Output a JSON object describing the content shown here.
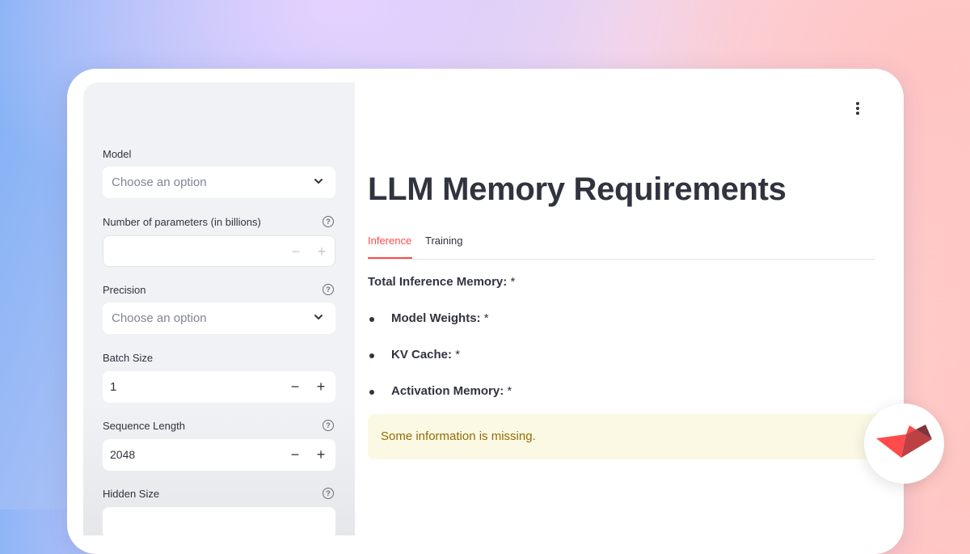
{
  "sidebar": {
    "model": {
      "label": "Model",
      "placeholder": "Choose an option"
    },
    "num_params": {
      "label": "Number of parameters (in billions)",
      "value": "",
      "minus": "−",
      "plus": "+"
    },
    "precision": {
      "label": "Precision",
      "placeholder": "Choose an option"
    },
    "batch_size": {
      "label": "Batch Size",
      "value": "1",
      "minus": "−",
      "plus": "+"
    },
    "sequence_length": {
      "label": "Sequence Length",
      "value": "2048",
      "minus": "−",
      "plus": "+"
    },
    "hidden_size": {
      "label": "Hidden Size"
    },
    "help_glyph": "?"
  },
  "main": {
    "title": "LLM Memory Requirements",
    "tabs": [
      {
        "label": "Inference",
        "active": true
      },
      {
        "label": "Training",
        "active": false
      }
    ],
    "total_inference": {
      "label": "Total Inference Memory:",
      "value": "*"
    },
    "items": [
      {
        "label": "Model Weights:",
        "value": "*"
      },
      {
        "label": "KV Cache:",
        "value": "*"
      },
      {
        "label": "Activation Memory:",
        "value": "*"
      }
    ],
    "alert": "Some information is missing."
  },
  "colors": {
    "accent": "#ff4b4b",
    "text": "#31333f",
    "sidebar_bg": "#f0f2f6",
    "alert_bg": "#fbf9e4",
    "alert_text": "#926c05"
  },
  "icons": [
    "chevron-down-icon",
    "help-icon",
    "more-vertical-icon",
    "streamlit-logo-icon"
  ]
}
